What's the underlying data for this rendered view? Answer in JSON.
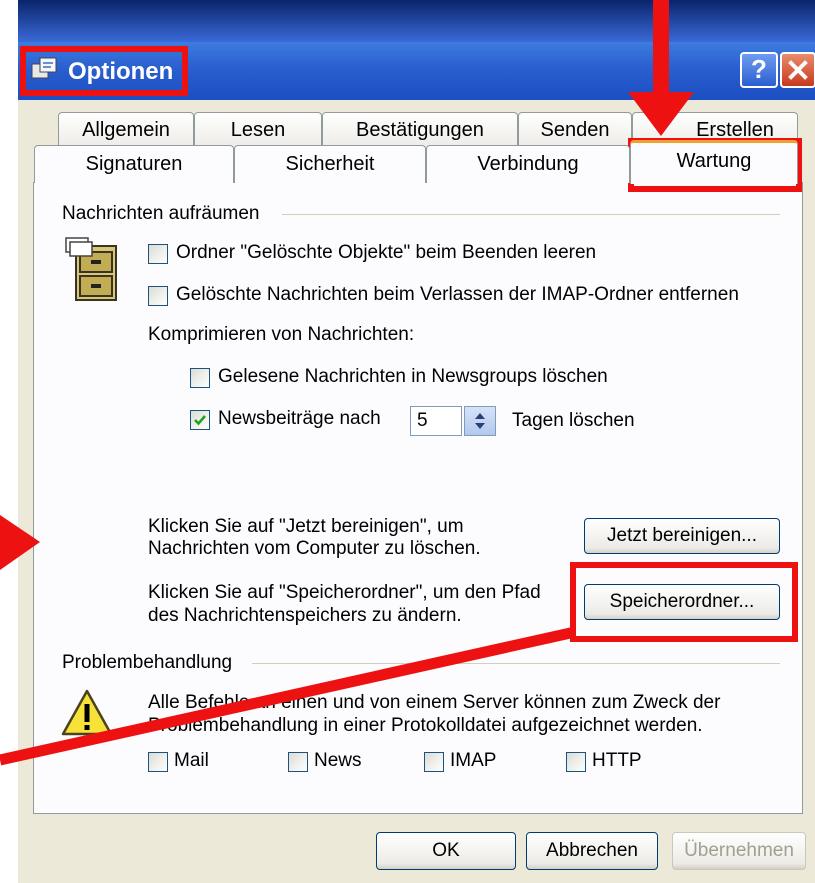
{
  "window": {
    "title": "Optionen",
    "help_label": "?"
  },
  "tabs": {
    "row_back": [
      {
        "label": "Allgemein"
      },
      {
        "label": "Lesen"
      },
      {
        "label": "Bestätigungen"
      },
      {
        "label": "Senden"
      },
      {
        "label": "Erstellen"
      }
    ],
    "row_front": [
      {
        "label": "Signaturen"
      },
      {
        "label": "Sicherheit"
      },
      {
        "label": "Verbindung"
      },
      {
        "label": "Wartung"
      }
    ]
  },
  "cleanup": {
    "group_title": "Nachrichten aufräumen",
    "option_empty_deleted": "Ordner \"Gelöschte Objekte\" beim Beenden leeren",
    "option_purge_imap": "Gelöschte Nachrichten beim Verlassen der IMAP-Ordner entfernen",
    "compress_label": "Komprimieren von Nachrichten:",
    "option_delete_read_news": "Gelesene Nachrichten in Newsgroups löschen",
    "option_delete_news_after": "Newsbeiträge nach",
    "days_value": "5",
    "days_suffix": "Tagen löschen",
    "clean_now_text_1": "Klicken Sie auf \"Jetzt bereinigen\", um",
    "clean_now_text_2": "Nachrichten vom Computer zu löschen.",
    "clean_now_button": "Jetzt bereinigen...",
    "store_folder_text_1": "Klicken Sie auf \"Speicherordner\", um den Pfad",
    "store_folder_text_2": "des Nachrichtenspeichers zu ändern.",
    "store_folder_button": "Speicherordner..."
  },
  "troubleshooting": {
    "group_title": "Problembehandlung",
    "description_1": "Alle Befehle an einen und von einem Server können zum Zweck der",
    "description_2": "Problembehandlung in einer Protokolldatei aufgezeichnet werden.",
    "options": [
      {
        "label": "Mail"
      },
      {
        "label": "News"
      },
      {
        "label": "IMAP"
      },
      {
        "label": "HTTP"
      }
    ]
  },
  "footer": {
    "ok": "OK",
    "cancel": "Abbrechen",
    "apply": "Übernehmen"
  },
  "colors": {
    "annotation_red": "#ee1111",
    "titlebar_blue": "#2a5fcf"
  }
}
